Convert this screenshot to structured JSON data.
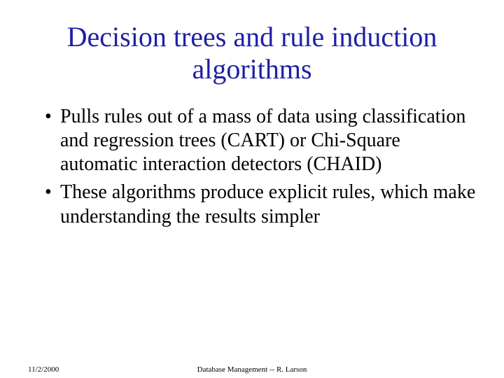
{
  "title": "Decision trees and rule induction algorithms",
  "bullets": [
    "Pulls rules out of a mass of data using classification and regression trees (CART) or Chi-Square automatic interaction detectors (CHAID)",
    "These algorithms produce explicit rules, which make understanding the results simpler"
  ],
  "footer": {
    "date": "11/2/2000",
    "center": "Database Management -- R. Larson"
  }
}
